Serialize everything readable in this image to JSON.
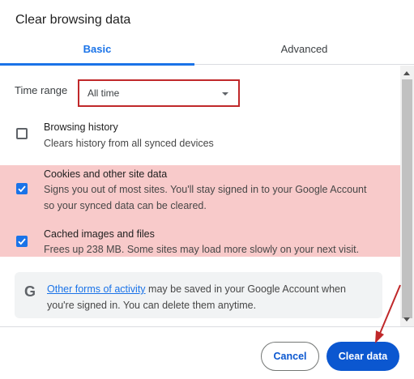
{
  "dialog": {
    "title": "Clear browsing data"
  },
  "tabs": [
    {
      "label": "Basic",
      "active": true
    },
    {
      "label": "Advanced",
      "active": false
    }
  ],
  "time_range": {
    "label": "Time range",
    "value": "All time"
  },
  "options": [
    {
      "title": "Browsing history",
      "description": "Clears history from all synced devices",
      "checked": false,
      "highlighted": false
    },
    {
      "title": "Cookies and other site data",
      "description_line1": "Signs you out of most sites. You'll stay signed in to your Google Account",
      "description_line2": "so your synced data can be cleared.",
      "checked": true,
      "highlighted": true
    },
    {
      "title": "Cached images and files",
      "description": "Frees up 238 MB. Some sites may load more slowly on your next visit.",
      "checked": true,
      "highlighted": true
    }
  ],
  "info": {
    "icon": "google-g-icon",
    "link_text": "Other forms of activity",
    "text_line1_rest": " may be saved in your Google Account when",
    "text_line2": "you're signed in. You can delete them anytime."
  },
  "footer": {
    "cancel_label": "Cancel",
    "clear_label": "Clear data"
  },
  "colors": {
    "accent": "#1a73e8",
    "primary_button": "#0b57d0",
    "highlight": "#f8caca",
    "annotation": "#c0282a"
  }
}
